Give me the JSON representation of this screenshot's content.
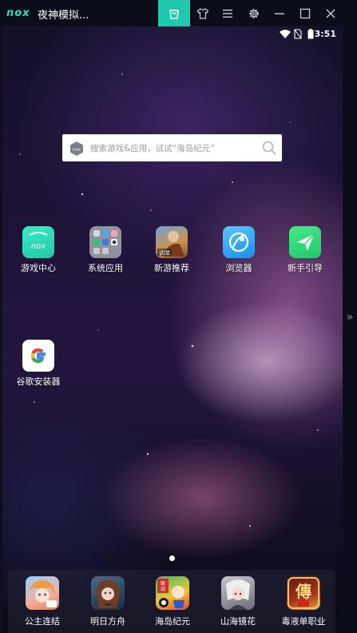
{
  "window": {
    "logo_text": "nox",
    "title": "夜神模拟..."
  },
  "toolbar": {
    "icons": [
      "shopping-bag-icon",
      "shirt-icon",
      "menu-icon",
      "gear-icon",
      "minimize-icon",
      "maximize-icon",
      "close-icon"
    ],
    "accent": "#20c9ad"
  },
  "status_bar": {
    "time": "3:51"
  },
  "search": {
    "placeholder": "搜索游戏&应用，试试“海岛纪元”"
  },
  "home_apps": [
    {
      "label": "游戏中心",
      "icon": "nox-game-center-icon"
    },
    {
      "label": "系统应用",
      "icon": "system-apps-folder-icon"
    },
    {
      "label": "新游推荐",
      "icon": "new-games-icon"
    },
    {
      "label": "浏览器",
      "icon": "browser-icon"
    },
    {
      "label": "新手引导",
      "icon": "guide-arrow-icon"
    },
    {
      "label": "谷歌安装器",
      "icon": "google-installer-icon"
    }
  ],
  "dock_apps": [
    {
      "label": "公主连结",
      "icon": "princess-connect-icon"
    },
    {
      "label": "明日方舟",
      "icon": "arknights-icon"
    },
    {
      "label": "海岛纪元",
      "icon": "island-era-icon"
    },
    {
      "label": "山海镜花",
      "icon": "shanhai-jinghua-icon"
    },
    {
      "label": "毒液单职业",
      "icon": "venom-legend-icon"
    }
  ]
}
